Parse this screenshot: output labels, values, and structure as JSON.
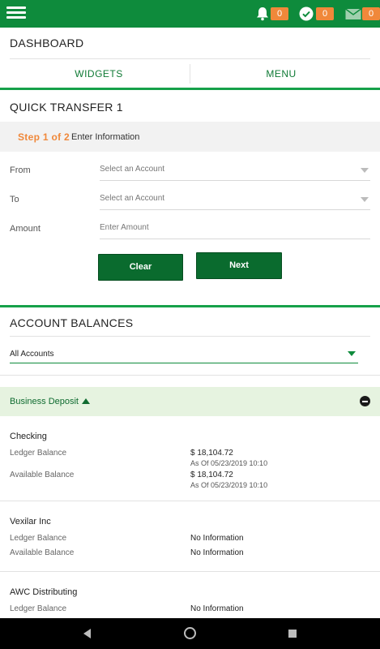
{
  "status_bar": {
    "notifications_count": "0",
    "approvals_count": "0",
    "messages_count": "0"
  },
  "dashboard": {
    "title": "DASHBOARD",
    "tabs": [
      "WIDGETS",
      "MENU"
    ]
  },
  "quick_transfer": {
    "title": "QUICK TRANSFER 1",
    "step_label": "Step 1 of 2",
    "step_text": "Enter Information",
    "from_label": "From",
    "from_placeholder": "Select an Account",
    "to_label": "To",
    "to_placeholder": "Select an Account",
    "amount_label": "Amount",
    "amount_placeholder": "Enter Amount",
    "clear_label": "Clear",
    "next_label": "Next"
  },
  "account_balances": {
    "title": "ACCOUNT BALANCES",
    "filter_value": "All Accounts",
    "group_label": "Business Deposit",
    "accounts": [
      {
        "name": "Checking",
        "ledger_label": "Ledger Balance",
        "ledger_value": "$ 18,104.72",
        "ledger_asof": "As Of 05/23/2019 10:10",
        "available_label": "Available Balance",
        "available_value": "$ 18,104.72",
        "available_asof": "As Of 05/23/2019 10:10"
      },
      {
        "name": "Vexilar Inc",
        "ledger_label": "Ledger Balance",
        "ledger_value": "No Information",
        "available_label": "Available Balance",
        "available_value": "No Information"
      },
      {
        "name": "AWC Distributing",
        "ledger_label": "Ledger Balance",
        "ledger_value": "No Information"
      }
    ]
  },
  "colors": {
    "brand_green": "#0e8b3c",
    "button_green": "#0a6b2e",
    "badge_orange": "#f0883a",
    "group_band": "#e6f3e0"
  },
  "icons": [
    "menu-icon",
    "bell-icon",
    "check-circle-icon",
    "mail-icon",
    "chevron-down-icon",
    "chevron-up-icon",
    "minus-circle-icon",
    "back-icon",
    "home-icon",
    "recents-icon"
  ]
}
